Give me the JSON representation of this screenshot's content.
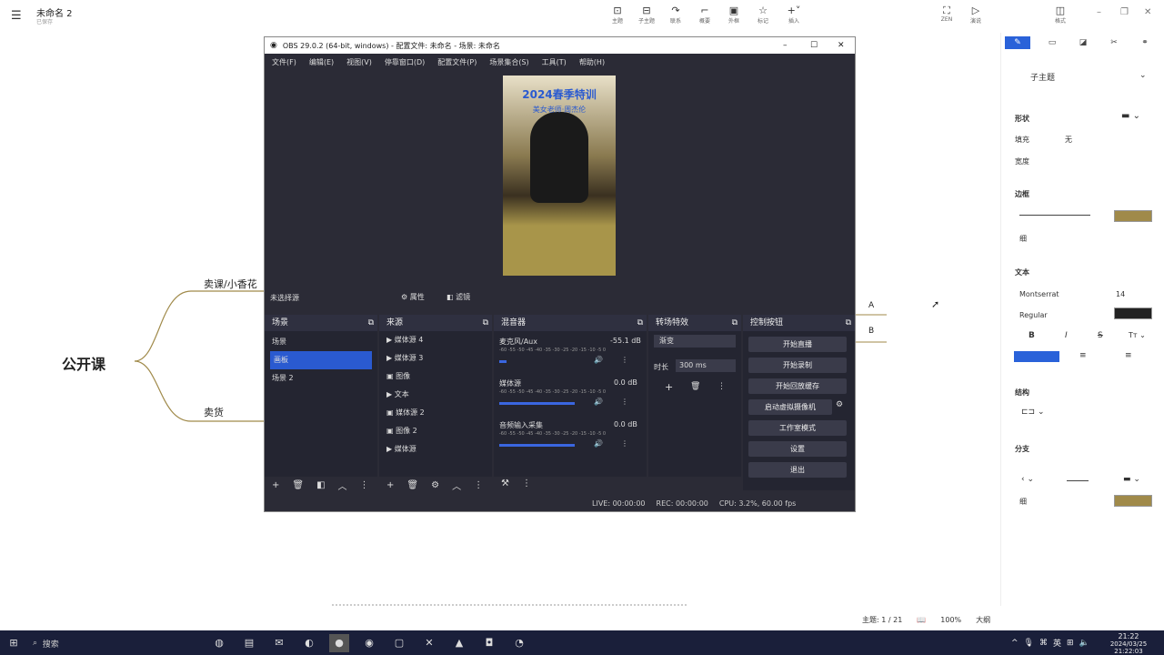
{
  "app": {
    "title": "未命名 2",
    "subtitle": "已保存",
    "toolbar": [
      {
        "icon": "subtopic-icon",
        "label": "主题"
      },
      {
        "icon": "child-topic-icon",
        "label": "子主题"
      },
      {
        "icon": "link-icon",
        "label": "联系"
      },
      {
        "icon": "summary-icon",
        "label": "概要"
      },
      {
        "icon": "boundary-icon",
        "label": "外框"
      },
      {
        "icon": "marker-icon",
        "label": "标记"
      },
      {
        "icon": "insert-icon",
        "label": "插入"
      }
    ],
    "right_toolbar": [
      {
        "icon": "zen-icon",
        "label": "ZEN"
      },
      {
        "icon": "present-icon",
        "label": "演说"
      },
      {
        "icon": "format-icon",
        "label": "格式"
      }
    ]
  },
  "mindmap": {
    "root": "公开课",
    "branches": [
      "卖课/小香花",
      "卖货"
    ],
    "side_nodes": [
      "A",
      "B"
    ]
  },
  "panel": {
    "topic_style": "子主题",
    "shape_label": "形状",
    "fill_label": "填充",
    "fill_value": "无",
    "width_label": "宽度",
    "border_label": "边框",
    "border_weight": "细",
    "text_label": "文本",
    "font": "Montserrat",
    "font_size": "14",
    "font_weight": "Regular",
    "structure_label": "结构",
    "branch_label": "分支",
    "branch_weight": "细",
    "colors": {
      "border": "#a08a4a",
      "text": "#222222",
      "branch": "#a08a4a",
      "accent": "#2a62d9"
    }
  },
  "obs": {
    "title": "OBS 29.0.2 (64-bit, windows) - 配置文件: 未命名 - 场景: 未命名",
    "menu": [
      "文件(F)",
      "编辑(E)",
      "视图(V)",
      "停靠窗口(D)",
      "配置文件(P)",
      "场景集合(S)",
      "工具(T)",
      "帮助(H)"
    ],
    "preview_overlay_title": "2024春季特训",
    "preview_overlay_sub": "美女老师·周杰伦",
    "source_bar": {
      "label": "未选择源",
      "props": "属性",
      "filters": "滤镜"
    },
    "docks": {
      "scenes": {
        "title": "场景",
        "items": [
          "场景",
          "画板",
          "场景 2"
        ],
        "selected": 1
      },
      "sources": {
        "title": "来源",
        "items": [
          "媒体源 4",
          "媒体源 3",
          "图像",
          "文本",
          "媒体源 2",
          "图像 2",
          "图像",
          "媒体源"
        ]
      },
      "mixer": {
        "title": "混音器",
        "channels": [
          {
            "name": "麦克风/Aux",
            "db": "-55.1 dB",
            "level": 0.08
          },
          {
            "name": "媒体源",
            "db": "0.0 dB",
            "level": 0.85
          },
          {
            "name": "音频输入采集",
            "db": "0.0 dB",
            "level": 0.85
          }
        ],
        "scale": "-60 -55 -50 -45 -40 -35 -30 -25 -20 -15 -10 -5 0"
      },
      "transitions": {
        "title": "转场特效",
        "type": "渐变",
        "duration_label": "时长",
        "duration": "300 ms"
      },
      "controls": {
        "title": "控制按钮",
        "buttons": [
          "开始直播",
          "开始录制",
          "开始回放缓存",
          "启动虚拟摄像机",
          "工作室模式",
          "设置",
          "退出"
        ]
      }
    },
    "status": {
      "live": "LIVE: 00:00:00",
      "rec": "REC: 00:00:00",
      "cpu": "CPU: 3.2%, 60.00 fps"
    }
  },
  "statusbar": {
    "topics": "主题: 1 / 21",
    "zoom": "100%",
    "mode": "大纲"
  },
  "taskbar": {
    "search_placeholder": "搜索",
    "time": "21:22",
    "date": "2024/03/25 21:22:03",
    "ime": "英"
  }
}
